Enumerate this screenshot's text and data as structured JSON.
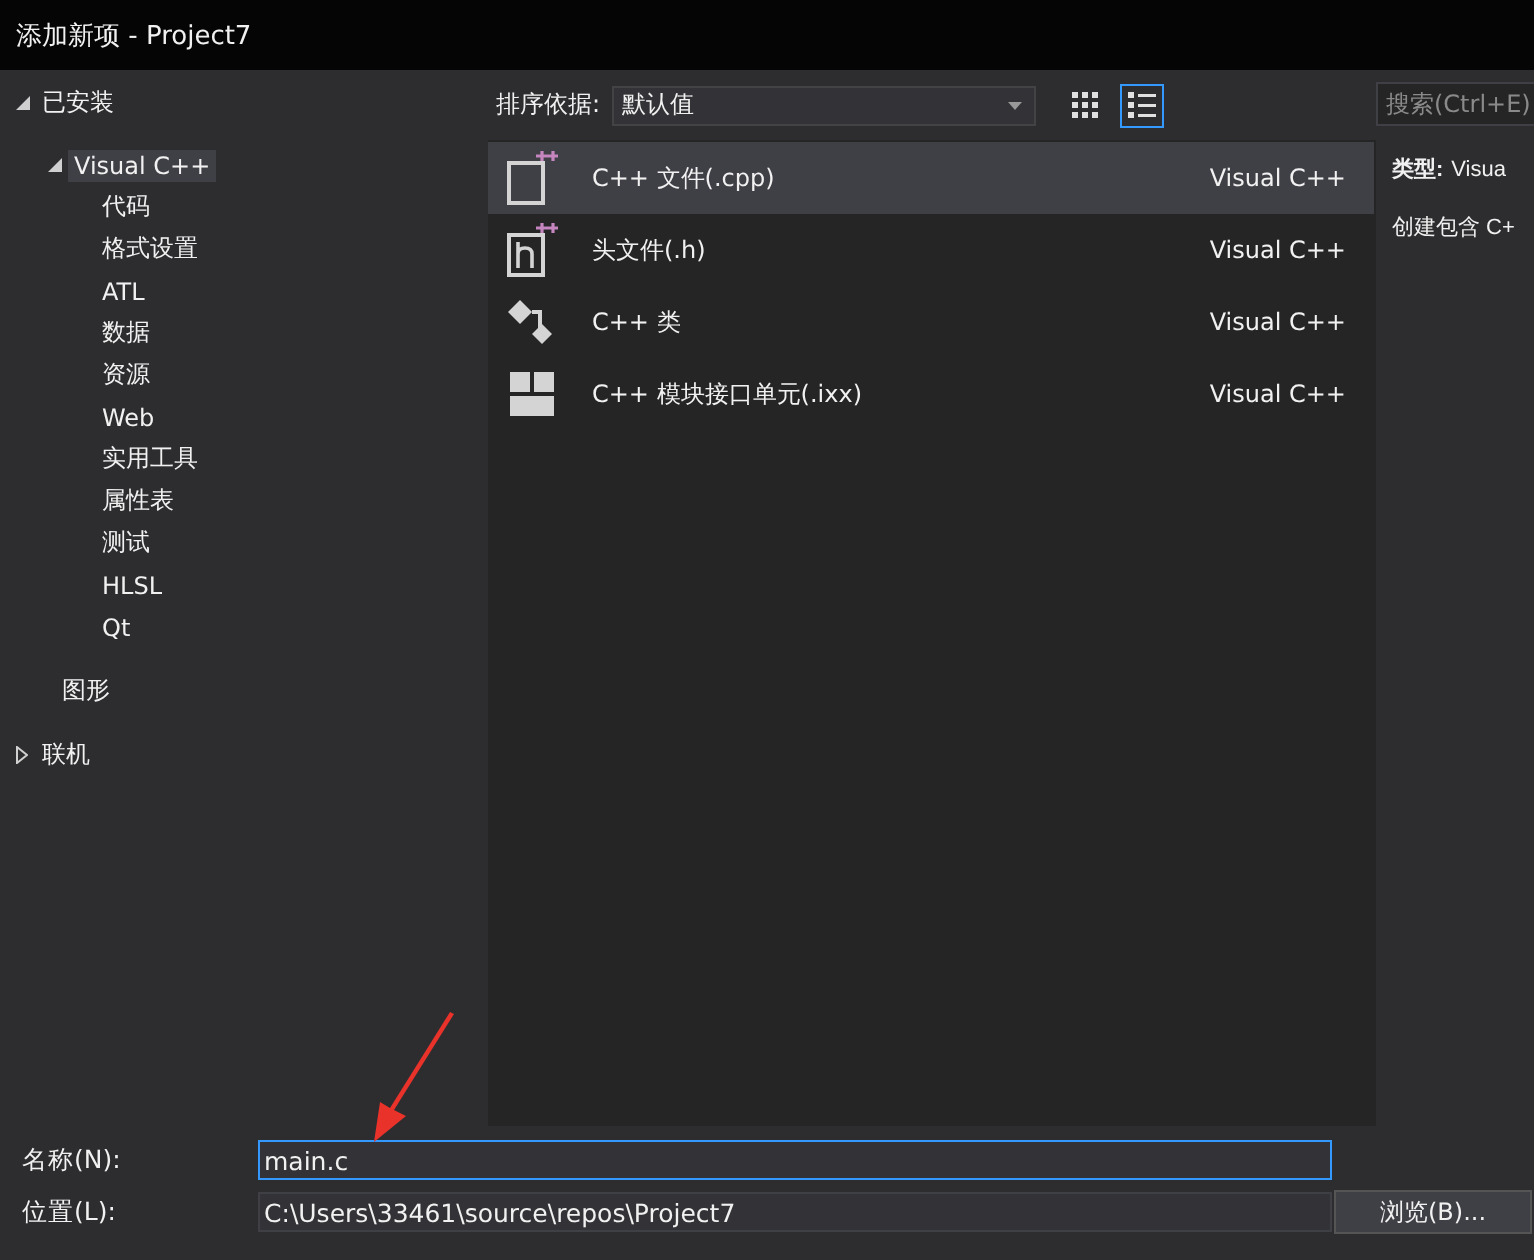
{
  "window": {
    "title": "添加新项 - Project7"
  },
  "tree": [
    {
      "label": "已安装",
      "expanded": true,
      "selected": false,
      "children": [
        {
          "label": "Visual C++",
          "expanded": true,
          "selected": true,
          "children": [
            {
              "label": "代码",
              "selected": false
            },
            {
              "label": "格式设置",
              "selected": false
            },
            {
              "label": "ATL",
              "selected": false
            },
            {
              "label": "数据",
              "selected": false
            },
            {
              "label": "资源",
              "selected": false
            },
            {
              "label": "Web",
              "selected": false
            },
            {
              "label": "实用工具",
              "selected": false
            },
            {
              "label": "属性表",
              "selected": false
            },
            {
              "label": "测试",
              "selected": false
            },
            {
              "label": "HLSL",
              "selected": false
            },
            {
              "label": "Qt",
              "selected": false
            }
          ]
        },
        {
          "label": "图形",
          "selected": false
        }
      ]
    },
    {
      "label": "联机",
      "expanded": false,
      "selected": false
    }
  ],
  "sort": {
    "label": "排序依据:",
    "value": "默认值"
  },
  "view_buttons": [
    {
      "kind": "grid",
      "selected": false
    },
    {
      "kind": "list",
      "selected": true
    }
  ],
  "search": {
    "placeholder": "搜索(Ctrl+E)"
  },
  "templates": [
    {
      "kind": "cpp-file",
      "name": "C++ 文件(.cpp)",
      "language": "Visual C++",
      "selected": true
    },
    {
      "kind": "header-file",
      "name": "头文件(.h)",
      "language": "Visual C++",
      "selected": false
    },
    {
      "kind": "class",
      "name": "C++ 类",
      "language": "Visual C++",
      "selected": false
    },
    {
      "kind": "module",
      "name": "C++ 模块接口单元(.ixx)",
      "language": "Visual C++",
      "selected": false
    }
  ],
  "details": {
    "type_label": "类型:",
    "type_value": "Visua",
    "description": "创建包含 C+"
  },
  "fields": [
    {
      "label": "名称(N):",
      "value": "main.c",
      "focused": true
    },
    {
      "label": "位置(L):",
      "value": "C:\\Users\\33461\\source\\repos\\Project7",
      "focused": false
    }
  ],
  "browse_button": "浏览(B)...",
  "annotation": {
    "kind": "arrow",
    "color": "#e8322a"
  }
}
